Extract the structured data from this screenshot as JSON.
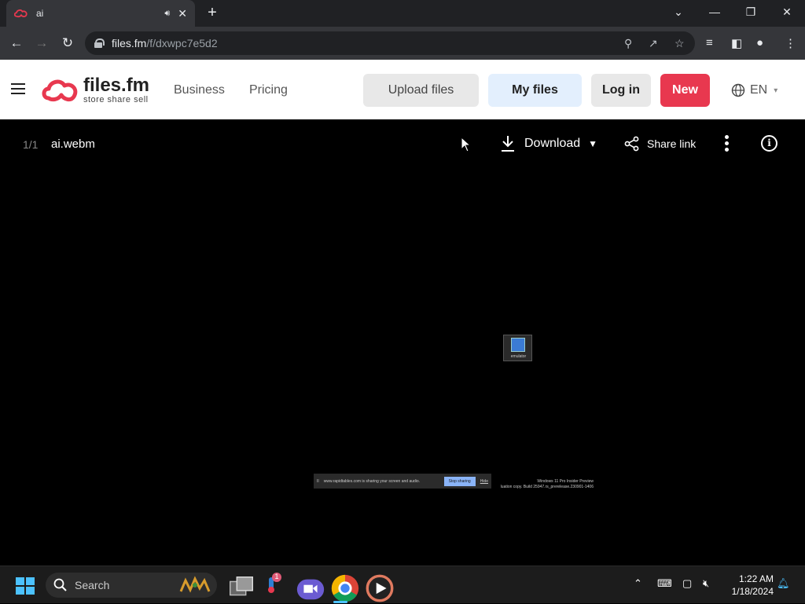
{
  "browser": {
    "tab_title": "ai",
    "url_host": "files.fm",
    "url_path": "/f/dxwpc7e5d2"
  },
  "site": {
    "logo_name": "files.fm",
    "logo_tagline": "store share sell",
    "nav": [
      "Business",
      "Pricing"
    ],
    "upload_label": "Upload files",
    "myfiles_label": "My files",
    "login_label": "Log in",
    "new_label": "New",
    "lang_label": "EN",
    "accent_color": "#e8384f"
  },
  "viewer": {
    "counter": "1/1",
    "filename": "ai.webm",
    "download_label": "Download",
    "share_label": "Share link",
    "frame": {
      "desktop_icon_label": "emulator",
      "share_notice": "www.rapidtables.com is sharing your screen and audio.",
      "stop_sharing": "Stop sharing",
      "hide": "Hide",
      "watermark_line1": "Windows 11 Pro Insider Preview",
      "watermark_line2": "luation copy. Build 25947.rs_prerelease.230901-1406"
    }
  },
  "taskbar": {
    "search_label": "Search",
    "notification_count": "1",
    "time": "1:22 AM",
    "date": "1/18/2024"
  }
}
